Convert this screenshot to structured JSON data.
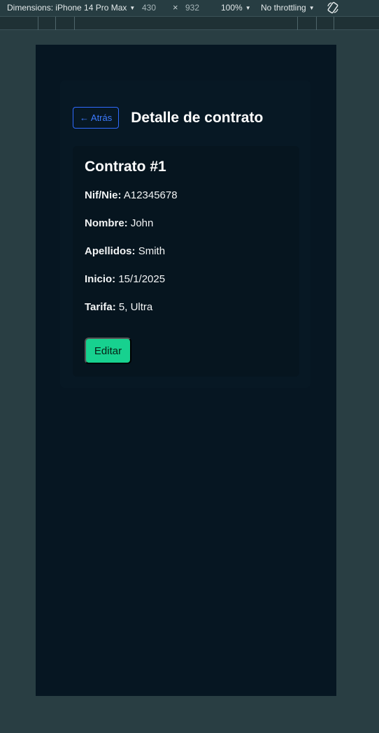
{
  "devtools": {
    "dimensions_label": "Dimensions: iPhone 14 Pro Max",
    "width": "430",
    "times": "×",
    "height": "932",
    "zoom": "100%",
    "throttling": "No throttling",
    "caret_icon": "caret-down-icon",
    "rotate_icon": "rotate-icon"
  },
  "page": {
    "back_label": "← Atrás",
    "title": "Detalle de contrato"
  },
  "contract": {
    "title": "Contrato #1",
    "fields": [
      {
        "label": "Nif/Nie:",
        "value": "A12345678"
      },
      {
        "label": "Nombre:",
        "value": "John"
      },
      {
        "label": "Apellidos:",
        "value": "Smith"
      },
      {
        "label": "Inicio:",
        "value": "15/1/2025"
      },
      {
        "label": "Tarifa:",
        "value": "5, Ultra"
      }
    ],
    "edit_label": "Editar"
  },
  "colors": {
    "accent_blue": "#2f6bff",
    "edit_green": "#17d18f",
    "viewport_bg": "#061622"
  }
}
